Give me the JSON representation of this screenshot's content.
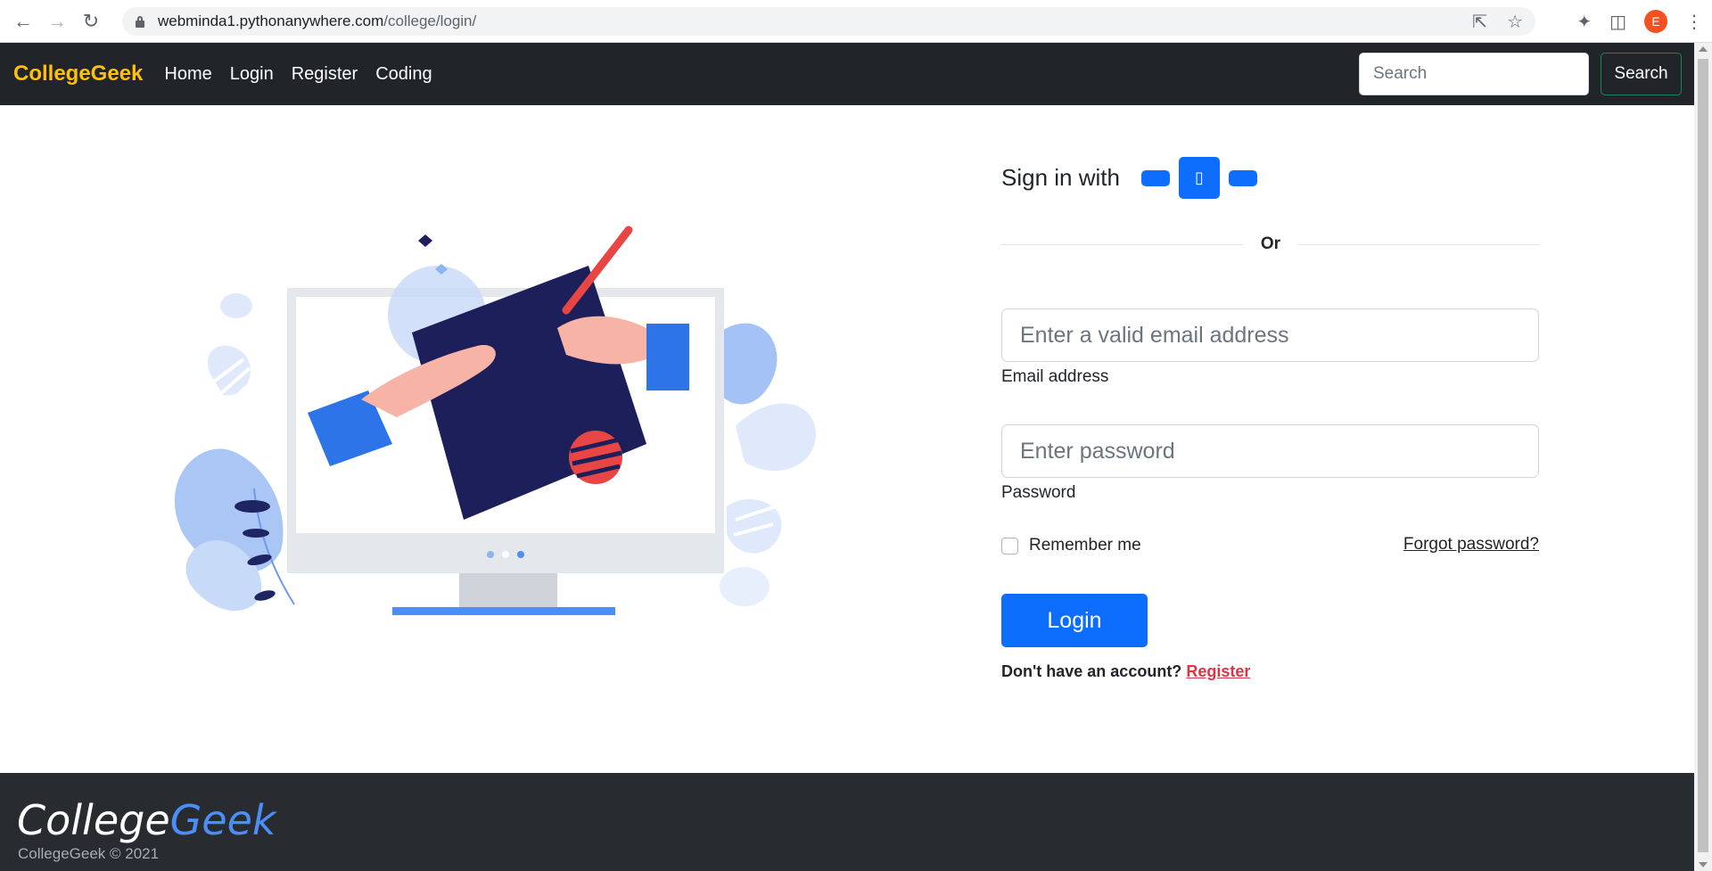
{
  "browser": {
    "url_host": "webminda1.pythonanywhere.com",
    "url_path": "/college/login/",
    "profile_initial": "E"
  },
  "navbar": {
    "brand": "CollegeGeek",
    "links": [
      "Home",
      "Login",
      "Register",
      "Coding"
    ],
    "search_placeholder": "Search",
    "search_button": "Search"
  },
  "login": {
    "sign_in_with": "Sign in with",
    "social_icon_glyph": "▯",
    "or_text": "Or",
    "email_placeholder": "Enter a valid email address",
    "email_label": "Email address",
    "password_placeholder": "Enter password",
    "password_label": "Password",
    "remember_me": "Remember me",
    "forgot_password": "Forgot password?",
    "login_button": "Login",
    "no_account_text": "Don't have an account?",
    "register_link": "Register"
  },
  "footer": {
    "logo_part1": "College",
    "logo_part2": "Geek",
    "copyright": "CollegeGeek © 2021"
  },
  "colors": {
    "navbar_bg": "#212529",
    "brand": "#ffc107",
    "primary": "#0d6efd",
    "register_link": "#dc3545",
    "footer_bg": "#282c31"
  }
}
